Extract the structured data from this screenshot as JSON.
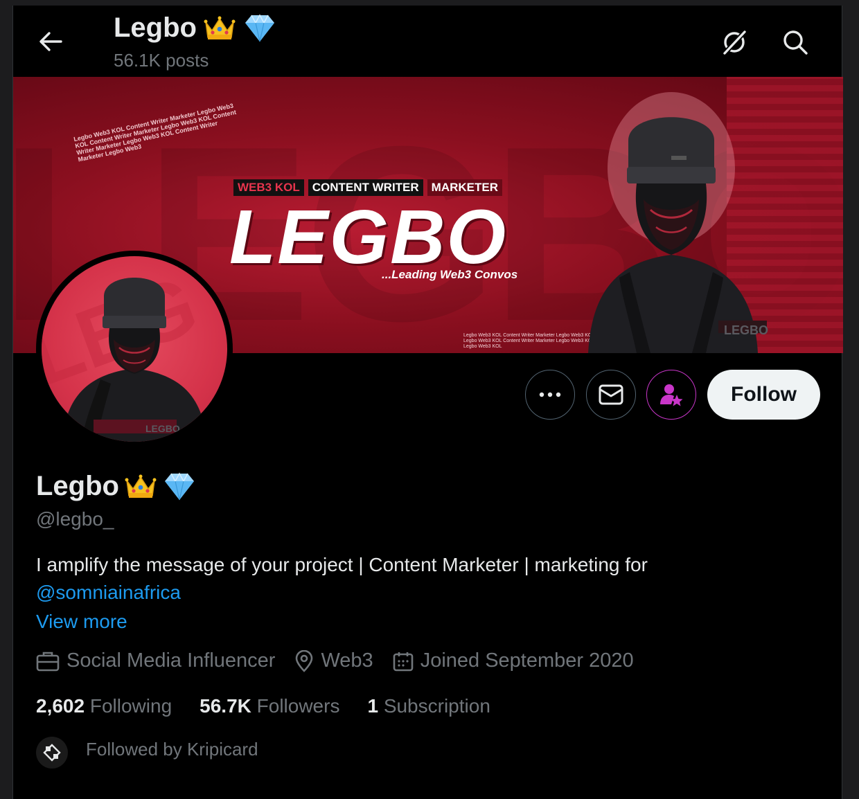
{
  "header": {
    "name": "Legbo",
    "posts": "56.1K posts"
  },
  "banner": {
    "tags": [
      "WEB3 KOL",
      "CONTENT WRITER",
      "MARKETER"
    ],
    "logo": "LEGBO",
    "subtitle": "...Leading Web3 Convos",
    "avatar_mark": "LEGBO"
  },
  "actions": {
    "follow_label": "Follow"
  },
  "profile": {
    "name": "Legbo",
    "handle": "@legbo_",
    "bio": "I amplify the message of your project | Content Marketer | marketing for",
    "bio_mention": "@somniainafrica",
    "view_more": "View more",
    "category": "Social Media Influencer",
    "location": "Web3",
    "joined": "Joined September 2020"
  },
  "stats": {
    "following_count": "2,602",
    "following_label": "Following",
    "followers_count": "56.7K",
    "followers_label": "Followers",
    "subscription_count": "1",
    "subscription_label": "Subscription"
  },
  "followed_by": "Followed by Kripicard",
  "icons": {
    "back": "arrow-left-icon",
    "grok": "grok-icon",
    "search": "search-icon",
    "more": "more-icon",
    "message": "envelope-icon",
    "subscribe": "subscribe-star-icon",
    "crown": "crown-emoji-icon",
    "diamond": "diamond-emoji-icon",
    "briefcase": "briefcase-icon",
    "location": "location-pin-icon",
    "calendar": "calendar-icon"
  },
  "colors": {
    "background": "#000000",
    "link": "#1d9bf0",
    "muted": "#71767b",
    "subscribe_accent": "#c936c9",
    "banner_red": "#a3162a"
  }
}
